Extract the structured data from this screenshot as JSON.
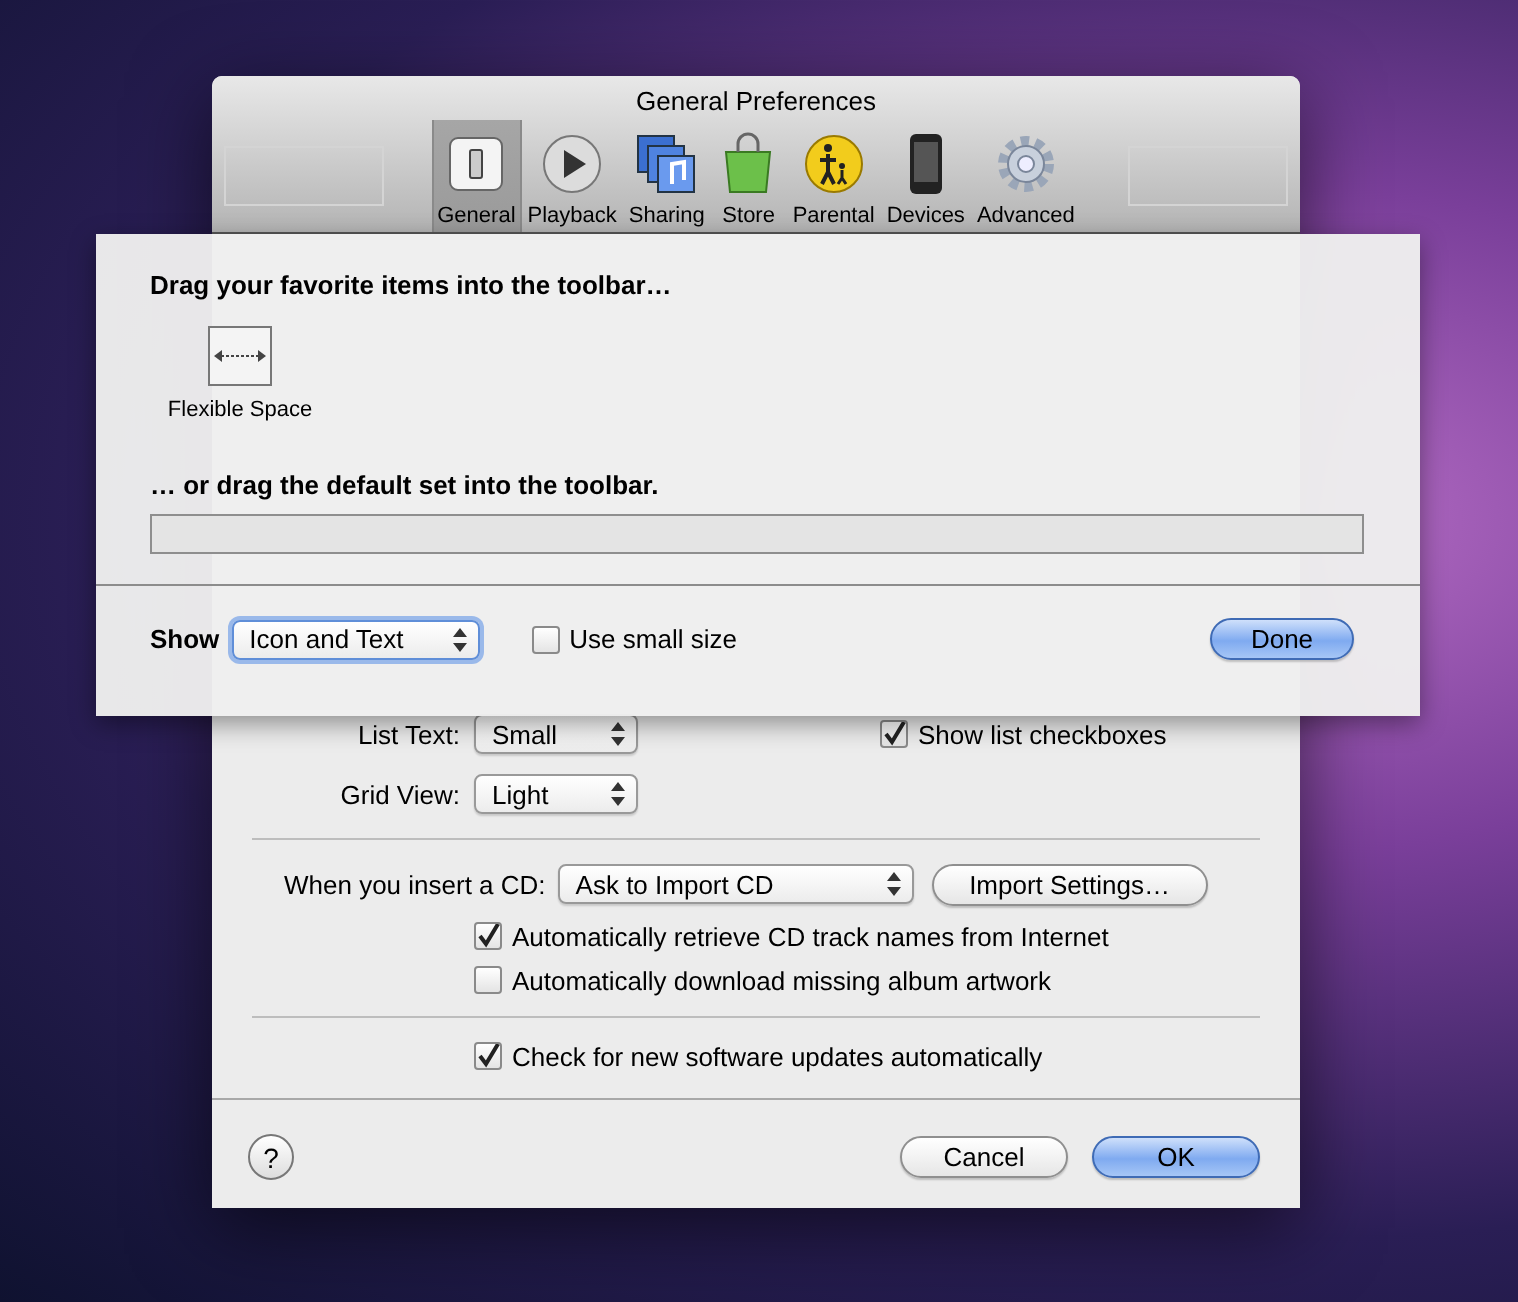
{
  "window": {
    "title": "General Preferences"
  },
  "toolbar": [
    {
      "label": "General",
      "selected": true
    },
    {
      "label": "Playback",
      "selected": false
    },
    {
      "label": "Sharing",
      "selected": false
    },
    {
      "label": "Store",
      "selected": false
    },
    {
      "label": "Parental",
      "selected": false
    },
    {
      "label": "Devices",
      "selected": false
    },
    {
      "label": "Advanced",
      "selected": false
    }
  ],
  "customize_sheet": {
    "heading": "Drag your favorite items into the toolbar…",
    "items": [
      {
        "label": "Flexible Space"
      }
    ],
    "default_set_heading": "… or drag the default set into the toolbar.",
    "show_label": "Show",
    "show_select": "Icon and Text",
    "small_size": {
      "label": "Use small size",
      "checked": false
    },
    "done": "Done"
  },
  "list_text": {
    "label": "List Text:",
    "value": "Small"
  },
  "show_list_checkboxes": {
    "label": "Show list checkboxes",
    "checked": true
  },
  "grid_view": {
    "label": "Grid View:",
    "value": "Light"
  },
  "cd": {
    "label": "When you insert a CD:",
    "value": "Ask to Import CD",
    "button": "Import Settings…"
  },
  "cd_options": [
    {
      "label": "Automatically retrieve CD track names from Internet",
      "checked": true
    },
    {
      "label": "Automatically download missing album artwork",
      "checked": false
    }
  ],
  "updates": {
    "label": "Check for new software updates automatically",
    "checked": true
  },
  "help": "?",
  "buttons": {
    "cancel": "Cancel",
    "ok": "OK"
  }
}
